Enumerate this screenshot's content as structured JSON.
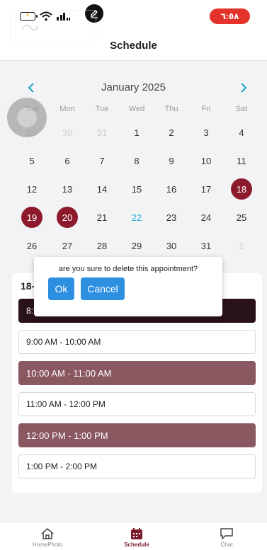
{
  "status": {
    "time": "٦:٥٨",
    "time_color": "#e4322b"
  },
  "header": {
    "title": "Schedule"
  },
  "calendar": {
    "month_label": "January 2025",
    "accent": "#1aa7c7",
    "selected_color": "#8c1a2c",
    "weekdays": [
      "Sun",
      "Mon",
      "Tue",
      "Wed",
      "Thu",
      "Fri",
      "Sat"
    ],
    "weeks": [
      [
        {
          "d": "29",
          "m": true
        },
        {
          "d": "30",
          "m": true
        },
        {
          "d": "31",
          "m": true
        },
        {
          "d": "1"
        },
        {
          "d": "2"
        },
        {
          "d": "3"
        },
        {
          "d": "4"
        }
      ],
      [
        {
          "d": "5"
        },
        {
          "d": "6"
        },
        {
          "d": "7"
        },
        {
          "d": "8"
        },
        {
          "d": "9"
        },
        {
          "d": "10"
        },
        {
          "d": "11"
        }
      ],
      [
        {
          "d": "12"
        },
        {
          "d": "13"
        },
        {
          "d": "14"
        },
        {
          "d": "15"
        },
        {
          "d": "16"
        },
        {
          "d": "17"
        },
        {
          "d": "18",
          "s": true
        }
      ],
      [
        {
          "d": "19",
          "s": true
        },
        {
          "d": "20",
          "s": true
        },
        {
          "d": "21"
        },
        {
          "d": "22",
          "t": true
        },
        {
          "d": "23"
        },
        {
          "d": "24"
        },
        {
          "d": "25"
        }
      ],
      [
        {
          "d": "26"
        },
        {
          "d": "27"
        },
        {
          "d": "28"
        },
        {
          "d": "29"
        },
        {
          "d": "30"
        },
        {
          "d": "31"
        },
        {
          "d": "1",
          "m": true
        }
      ]
    ]
  },
  "slots": {
    "date_heading": "18-",
    "items": [
      {
        "label": "8:",
        "state": "active"
      },
      {
        "label": "9:00 AM - 10:00 AM",
        "state": "free"
      },
      {
        "label": "10:00 AM - 11:00 AM",
        "state": "booked"
      },
      {
        "label": "11:00 AM - 12:00 PM",
        "state": "free"
      },
      {
        "label": "12:00 PM - 1:00 PM",
        "state": "booked"
      },
      {
        "label": "1:00 PM - 2:00 PM",
        "state": "free"
      }
    ]
  },
  "dialog": {
    "message": "are you sure to delete this appointment?",
    "ok_label": "Ok",
    "cancel_label": "Cancel",
    "button_color": "#2d8fe0"
  },
  "tabbar": {
    "items": [
      {
        "label": "HomePhoto",
        "icon": "home-icon",
        "active": false
      },
      {
        "label": "Schedule",
        "icon": "calendar-icon",
        "active": true
      },
      {
        "label": "Chat",
        "icon": "chat-bubble-icon",
        "active": false
      }
    ]
  }
}
